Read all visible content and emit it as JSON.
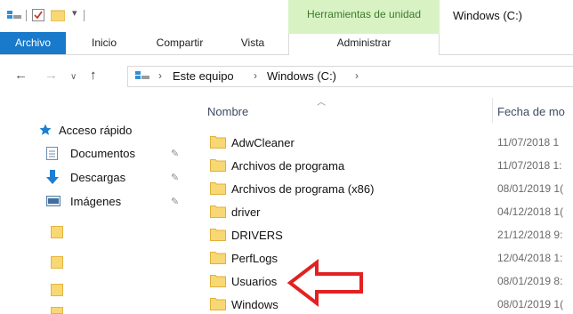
{
  "window": {
    "context_tab_group": "Herramientas de unidad",
    "title": "Windows (C:)"
  },
  "ribbon": {
    "tabs": [
      {
        "label": "Archivo"
      },
      {
        "label": "Inicio"
      },
      {
        "label": "Compartir"
      },
      {
        "label": "Vista"
      },
      {
        "label": "Administrar"
      }
    ]
  },
  "address": {
    "crumbs": [
      "Este equipo",
      "Windows (C:)"
    ]
  },
  "nav": {
    "items": [
      {
        "label": "Acceso rápido",
        "icon": "star-icon",
        "pinned": false
      },
      {
        "label": "Documentos",
        "icon": "documents-icon",
        "pinned": true
      },
      {
        "label": "Descargas",
        "icon": "download-arrow-icon",
        "pinned": true
      },
      {
        "label": "Imágenes",
        "icon": "pictures-icon",
        "pinned": true
      }
    ]
  },
  "list": {
    "columns": {
      "name": "Nombre",
      "date": "Fecha de mo"
    },
    "rows": [
      {
        "name": "AdwCleaner",
        "date": "11/07/2018 1"
      },
      {
        "name": "Archivos de programa",
        "date": "11/07/2018 1:"
      },
      {
        "name": "Archivos de programa (x86)",
        "date": "08/01/2019 1("
      },
      {
        "name": "driver",
        "date": "04/12/2018 1("
      },
      {
        "name": "DRIVERS",
        "date": "21/12/2018 9:"
      },
      {
        "name": "PerfLogs",
        "date": "12/04/2018 1:"
      },
      {
        "name": "Usuarios",
        "date": "08/01/2019 8:"
      },
      {
        "name": "Windows",
        "date": "08/01/2019 1("
      }
    ]
  },
  "colors": {
    "accent": "#1979ca",
    "context_tab": "#d8f2c4",
    "folder": "#f8d775",
    "annotation_arrow": "#e32121"
  }
}
